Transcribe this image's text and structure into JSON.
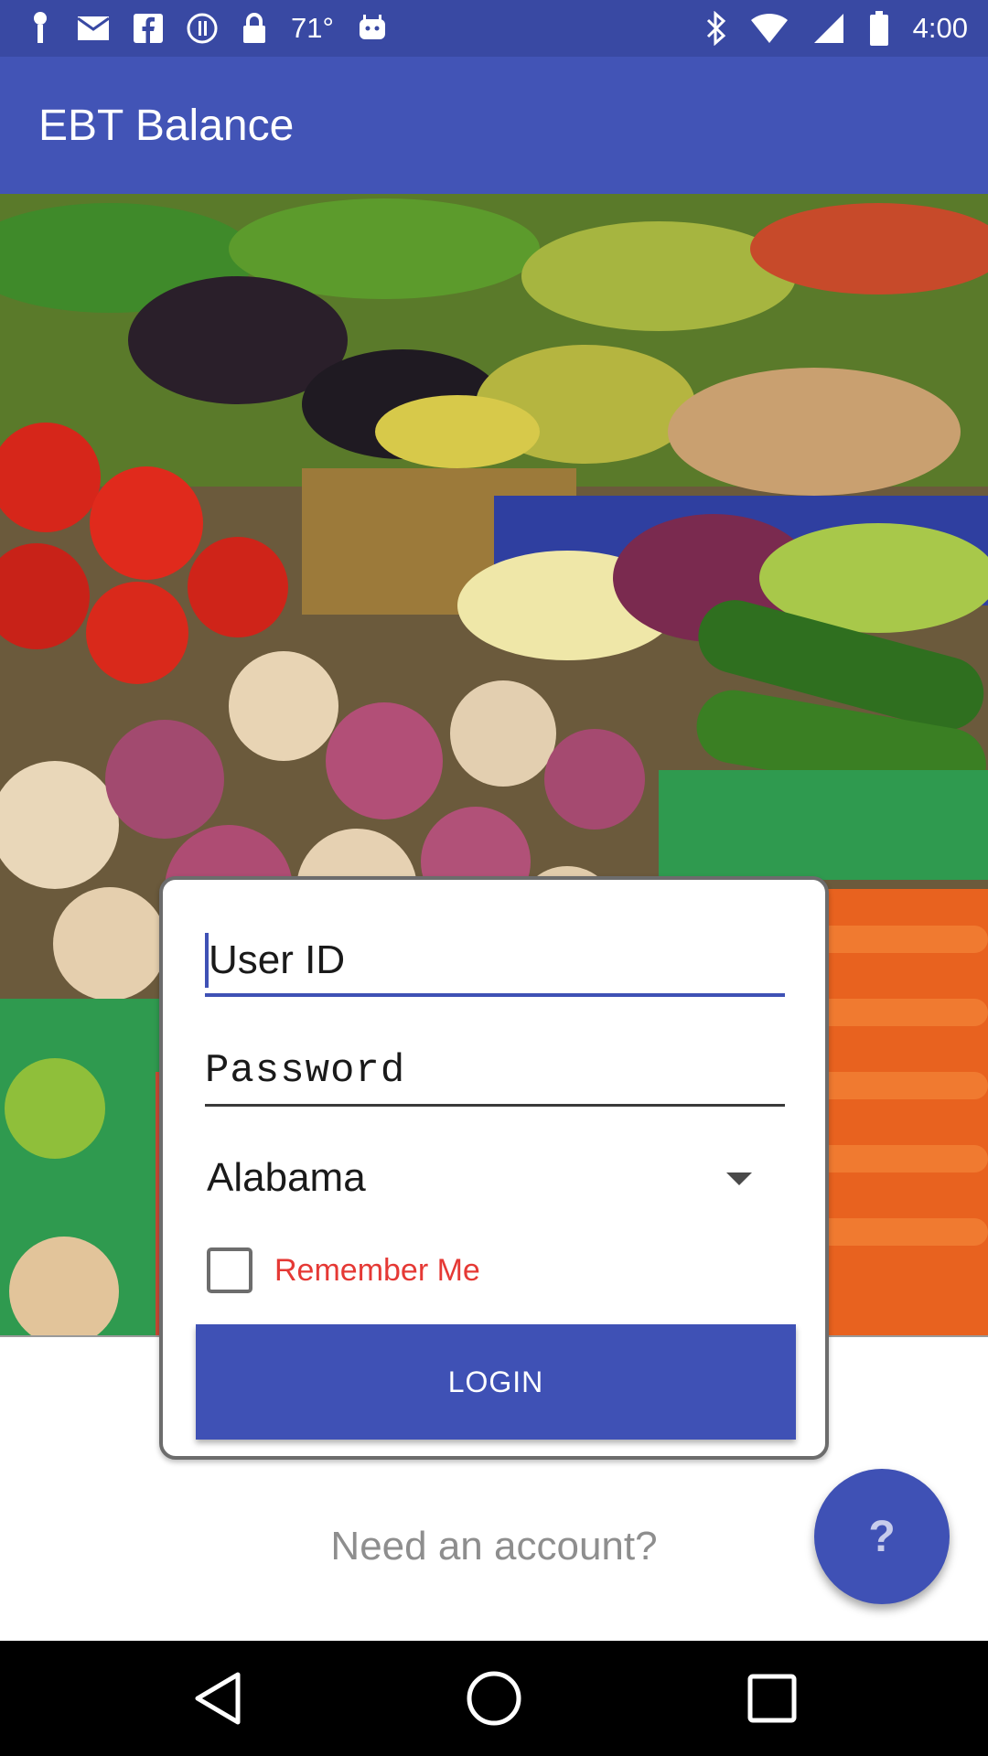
{
  "status_bar": {
    "temperature": "71°",
    "time": "4:00",
    "icons": [
      "notification-icon",
      "mail-icon",
      "facebook-icon",
      "sync-icon",
      "lock-icon",
      "weather-icon",
      "android-icon",
      "bluetooth-icon",
      "wifi-icon",
      "signal-icon",
      "battery-icon"
    ]
  },
  "app_bar": {
    "title": "EBT Balance"
  },
  "login_form": {
    "user_id_placeholder": "User ID",
    "password_placeholder": "Password",
    "state_selected": "Alabama",
    "remember_me_label": "Remember Me",
    "login_button_label": "LOGIN"
  },
  "footer": {
    "need_account_label": "Need an account?",
    "help_button_label": "?"
  },
  "colors": {
    "primary": "#3f51b5",
    "status_bar": "#3949a3",
    "accent_red": "#e53935"
  }
}
